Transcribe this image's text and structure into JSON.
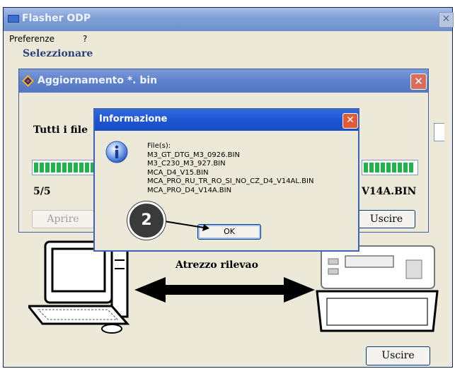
{
  "main_window": {
    "title": "Flasher ODP",
    "close_glyph": "✕",
    "menu": [
      "Preferenze",
      "?"
    ],
    "section_label": "Selezzionare",
    "middle_label": "Atrezzo rilevao",
    "uscire_label": "Uscire"
  },
  "update_window": {
    "title": "Aggiornamento *. bin",
    "close_glyph": "✕",
    "all_files_label": "Tutti i file",
    "count_label": "5/5",
    "current_file_label": "V14A.BIN",
    "aprire_label": "Aprire",
    "uscire_label": "Uscire",
    "progress_fraction": 1.0
  },
  "info_dialog": {
    "title": "Informazione",
    "close_glyph": "✕",
    "lines": [
      "File(s):",
      "M3_GT_DTG_M3_0926.BIN",
      "M3_C230_M3_927.BIN",
      "MCA_D4_V15.BIN",
      "MCA_PRO_RU_TR_RO_SI_NO_CZ_D4_V14AL.BIN",
      "MCA_PRO_D4_V14A.BIN"
    ],
    "ok_label": "OK"
  },
  "callout": {
    "number": "2"
  },
  "colors": {
    "titlebar_active": "#1d55d2",
    "close_red": "#e05b36",
    "progress_green": "#22b14c"
  },
  "icons": [
    "window-app-icon",
    "app-logo-icon",
    "info-icon",
    "close-icon",
    "pc-illustration",
    "device-illustration",
    "double-arrow-icon"
  ]
}
